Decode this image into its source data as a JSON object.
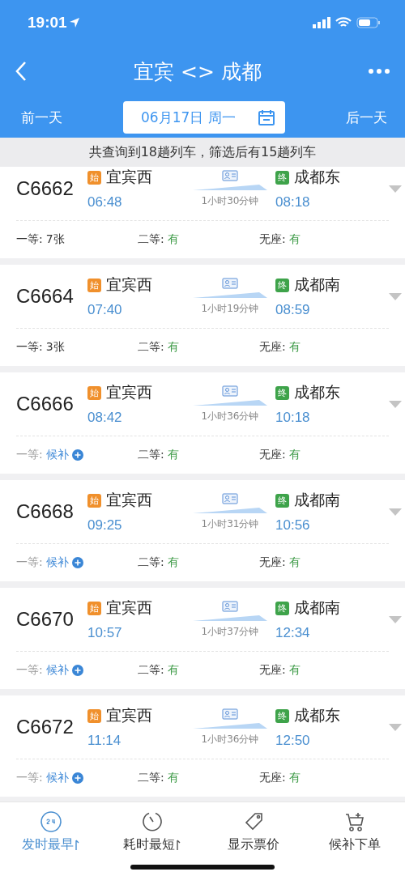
{
  "status_bar": {
    "time": "19:01"
  },
  "nav": {
    "title": "宜宾 <> 成都"
  },
  "date_bar": {
    "prev": "前一天",
    "date": "06月17日 周一",
    "next": "后一天"
  },
  "summary": "共查询到18趟列车，筛选后有15趟列车",
  "trains": [
    {
      "number": "C6662",
      "from_badge": "始",
      "from": "宜宾西",
      "depart": "06:48",
      "duration": "1小时30分钟",
      "to_badge": "终",
      "to": "成都东",
      "arrive": "08:18",
      "seats": [
        {
          "label": "一等:",
          "value": "7张",
          "kind": "count"
        },
        {
          "label": "二等:",
          "value": "有",
          "kind": "available"
        },
        {
          "label": "无座:",
          "value": "有",
          "kind": "available"
        }
      ]
    },
    {
      "number": "C6664",
      "from_badge": "始",
      "from": "宜宾西",
      "depart": "07:40",
      "duration": "1小时19分钟",
      "to_badge": "终",
      "to": "成都南",
      "arrive": "08:59",
      "seats": [
        {
          "label": "一等:",
          "value": "3张",
          "kind": "count"
        },
        {
          "label": "二等:",
          "value": "有",
          "kind": "available"
        },
        {
          "label": "无座:",
          "value": "有",
          "kind": "available"
        }
      ]
    },
    {
      "number": "C6666",
      "from_badge": "始",
      "from": "宜宾西",
      "depart": "08:42",
      "duration": "1小时36分钟",
      "to_badge": "终",
      "to": "成都东",
      "arrive": "10:18",
      "seats": [
        {
          "label": "一等:",
          "value": "候补",
          "kind": "waitlist"
        },
        {
          "label": "二等:",
          "value": "有",
          "kind": "available"
        },
        {
          "label": "无座:",
          "value": "有",
          "kind": "available"
        }
      ]
    },
    {
      "number": "C6668",
      "from_badge": "始",
      "from": "宜宾西",
      "depart": "09:25",
      "duration": "1小时31分钟",
      "to_badge": "终",
      "to": "成都南",
      "arrive": "10:56",
      "seats": [
        {
          "label": "一等:",
          "value": "候补",
          "kind": "waitlist"
        },
        {
          "label": "二等:",
          "value": "有",
          "kind": "available"
        },
        {
          "label": "无座:",
          "value": "有",
          "kind": "available"
        }
      ]
    },
    {
      "number": "C6670",
      "from_badge": "始",
      "from": "宜宾西",
      "depart": "10:57",
      "duration": "1小时37分钟",
      "to_badge": "终",
      "to": "成都南",
      "arrive": "12:34",
      "seats": [
        {
          "label": "一等:",
          "value": "候补",
          "kind": "waitlist"
        },
        {
          "label": "二等:",
          "value": "有",
          "kind": "available"
        },
        {
          "label": "无座:",
          "value": "有",
          "kind": "available"
        }
      ]
    },
    {
      "number": "C6672",
      "from_badge": "始",
      "from": "宜宾西",
      "depart": "11:14",
      "duration": "1小时36分钟",
      "to_badge": "终",
      "to": "成都东",
      "arrive": "12:50",
      "seats": [
        {
          "label": "一等:",
          "value": "候补",
          "kind": "waitlist"
        },
        {
          "label": "二等:",
          "value": "有",
          "kind": "available"
        },
        {
          "label": "无座:",
          "value": "有",
          "kind": "available"
        }
      ]
    }
  ],
  "bottom_tabs": [
    {
      "label": "发时最早",
      "sortable": true,
      "selected": true
    },
    {
      "label": "耗时最短",
      "sortable": true,
      "selected": false
    },
    {
      "label": "显示票价",
      "sortable": false,
      "selected": false
    },
    {
      "label": "候补下单",
      "sortable": false,
      "selected": false
    }
  ]
}
